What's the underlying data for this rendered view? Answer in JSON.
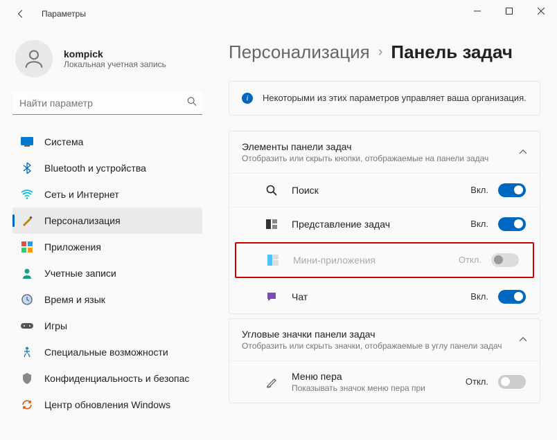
{
  "window": {
    "title": "Параметры"
  },
  "user": {
    "name": "kompick",
    "subtitle": "Локальная учетная запись"
  },
  "search": {
    "placeholder": "Найти параметр"
  },
  "nav": {
    "items": [
      {
        "label": "Система"
      },
      {
        "label": "Bluetooth и устройства"
      },
      {
        "label": "Сеть и Интернет"
      },
      {
        "label": "Персонализация"
      },
      {
        "label": "Приложения"
      },
      {
        "label": "Учетные записи"
      },
      {
        "label": "Время и язык"
      },
      {
        "label": "Игры"
      },
      {
        "label": "Специальные возможности"
      },
      {
        "label": "Конфиденциальность и безопас"
      },
      {
        "label": "Центр обновления Windows"
      }
    ]
  },
  "breadcrumb": {
    "parent": "Персонализация",
    "current": "Панель задач"
  },
  "info": {
    "text": "Некоторыми из этих параметров управляет ваша организация."
  },
  "section1": {
    "title": "Элементы панели задач",
    "sub": "Отобразить или скрыть кнопки, отображаемые на панели задач",
    "rows": [
      {
        "label": "Поиск",
        "state": "Вкл."
      },
      {
        "label": "Представление задач",
        "state": "Вкл."
      },
      {
        "label": "Мини-приложения",
        "state": "Откл."
      },
      {
        "label": "Чат",
        "state": "Вкл."
      }
    ]
  },
  "section2": {
    "title": "Угловые значки панели задач",
    "sub": "Отобразить или скрыть значки, отображаемые в углу панели задач",
    "rows": [
      {
        "label": "Меню пера",
        "sub": "Показывать значок меню пера при",
        "state": "Откл."
      }
    ]
  }
}
